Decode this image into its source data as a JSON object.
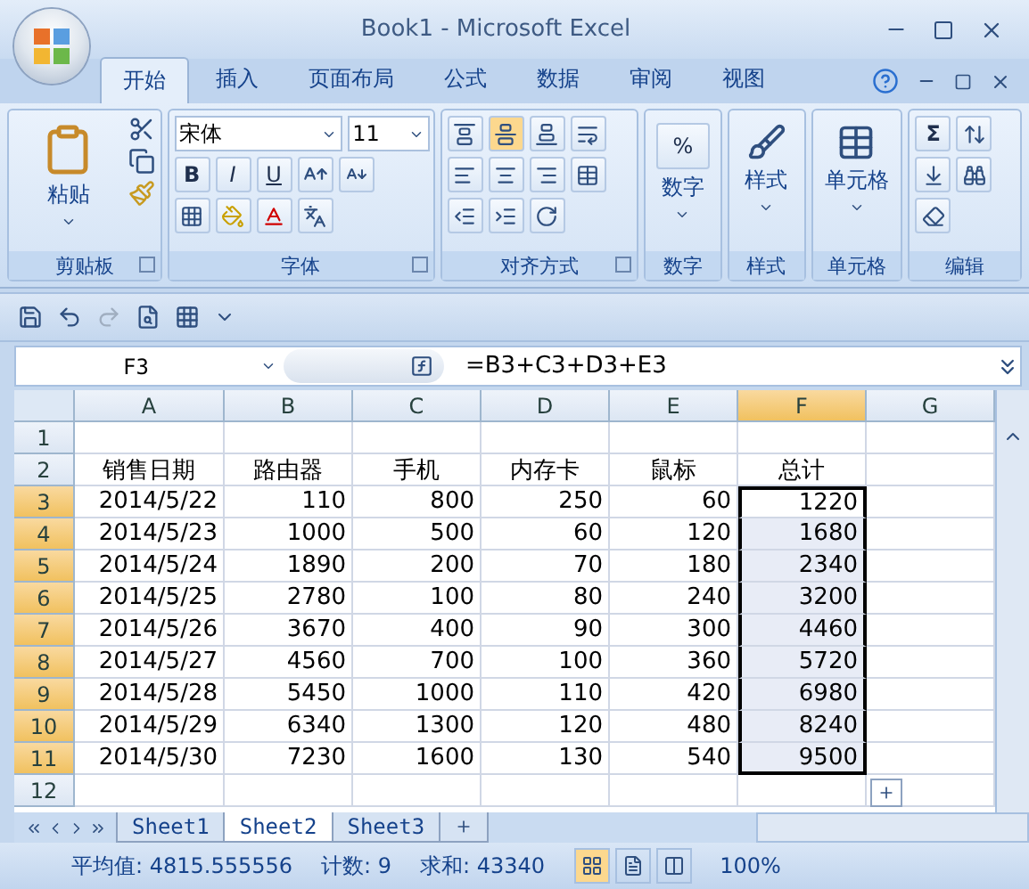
{
  "window": {
    "title": "Book1 - Microsoft Excel"
  },
  "tabs": [
    {
      "label": "开始",
      "selected": true
    },
    {
      "label": "插入",
      "selected": false
    },
    {
      "label": "页面布局",
      "selected": false
    },
    {
      "label": "公式",
      "selected": false
    },
    {
      "label": "数据",
      "selected": false
    },
    {
      "label": "审阅",
      "selected": false
    },
    {
      "label": "视图",
      "selected": false
    }
  ],
  "ribbon": {
    "clipboard": {
      "title": "剪贴板",
      "paste": "粘贴"
    },
    "font": {
      "title": "字体",
      "font_name": "宋体",
      "font_size": "11",
      "bold": "B",
      "italic": "I",
      "underline": "U"
    },
    "alignment": {
      "title": "对齐方式",
      "vertical": [
        {
          "selected": false
        },
        {
          "selected": true
        },
        {
          "selected": false
        }
      ]
    },
    "big_groups": [
      {
        "kind": "number",
        "label": "数字",
        "title": "数字",
        "glyph": "%"
      },
      {
        "kind": "styles",
        "label": "样式",
        "title": "样式"
      },
      {
        "kind": "cells",
        "label": "单元格",
        "title": "单元格"
      }
    ],
    "editing": {
      "title": "编辑",
      "sum": "Σ"
    }
  },
  "formula_bar": {
    "name_box": "F3",
    "formula": "=B3+C3+D3+E3"
  },
  "columns": [
    {
      "label": "A",
      "selected": false
    },
    {
      "label": "B",
      "selected": false
    },
    {
      "label": "C",
      "selected": false
    },
    {
      "label": "D",
      "selected": false
    },
    {
      "label": "E",
      "selected": false
    },
    {
      "label": "F",
      "selected": true
    },
    {
      "label": "G",
      "selected": false
    }
  ],
  "rows": [
    {
      "number": "1",
      "kind": "empty",
      "selected": false,
      "active": false
    },
    {
      "number": "2",
      "kind": "header",
      "selected": false,
      "active": false,
      "cells": [
        "销售日期",
        "路由器",
        "手机",
        "内存卡",
        "鼠标",
        "总计"
      ]
    },
    {
      "number": "3",
      "kind": "data",
      "selected": true,
      "active": true,
      "cells": [
        "2014/5/22",
        "110",
        "800",
        "250",
        "60",
        "1220"
      ]
    },
    {
      "number": "4",
      "kind": "data",
      "selected": true,
      "active": false,
      "cells": [
        "2014/5/23",
        "1000",
        "500",
        "60",
        "120",
        "1680"
      ]
    },
    {
      "number": "5",
      "kind": "data",
      "selected": true,
      "active": false,
      "cells": [
        "2014/5/24",
        "1890",
        "200",
        "70",
        "180",
        "2340"
      ]
    },
    {
      "number": "6",
      "kind": "data",
      "selected": true,
      "active": false,
      "cells": [
        "2014/5/25",
        "2780",
        "100",
        "80",
        "240",
        "3200"
      ]
    },
    {
      "number": "7",
      "kind": "data",
      "selected": true,
      "active": false,
      "cells": [
        "2014/5/26",
        "3670",
        "400",
        "90",
        "300",
        "4460"
      ]
    },
    {
      "number": "8",
      "kind": "data",
      "selected": true,
      "active": false,
      "cells": [
        "2014/5/27",
        "4560",
        "700",
        "100",
        "360",
        "5720"
      ]
    },
    {
      "number": "9",
      "kind": "data",
      "selected": true,
      "active": false,
      "cells": [
        "2014/5/28",
        "5450",
        "1000",
        "110",
        "420",
        "6980"
      ]
    },
    {
      "number": "10",
      "kind": "data",
      "selected": true,
      "active": false,
      "cells": [
        "2014/5/29",
        "6340",
        "1300",
        "120",
        "480",
        "8240"
      ]
    },
    {
      "number": "11",
      "kind": "data",
      "selected": true,
      "active": false,
      "cells": [
        "2014/5/30",
        "7230",
        "1600",
        "130",
        "540",
        "9500"
      ]
    },
    {
      "number": "12",
      "kind": "empty",
      "selected": false,
      "active": false
    }
  ],
  "sheets": [
    {
      "label": "Sheet1",
      "selected": false
    },
    {
      "label": "Sheet2",
      "selected": true
    },
    {
      "label": "Sheet3",
      "selected": false
    }
  ],
  "status_bar": {
    "average": "平均值: 4815.555556",
    "count": "计数: 9",
    "sum": "求和: 43340",
    "views": [
      {
        "kind": "normal",
        "selected": true
      },
      {
        "kind": "layout",
        "selected": false
      },
      {
        "kind": "break",
        "selected": false
      }
    ],
    "zoom": "100%"
  }
}
